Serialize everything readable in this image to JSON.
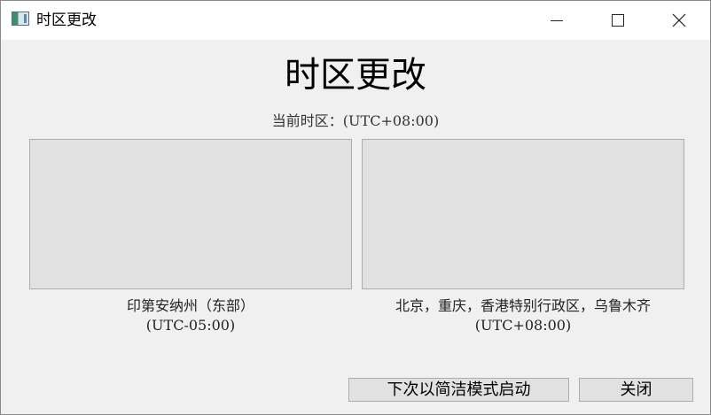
{
  "window": {
    "title": "时区更改"
  },
  "main": {
    "heading": "时区更改",
    "current_timezone": "当前时区：(UTC+08:00)"
  },
  "options": [
    {
      "name": "印第安纳州（东部）",
      "offset": "(UTC-05:00)"
    },
    {
      "name": "北京，重庆，香港特别行政区，乌鲁木齐",
      "offset": "(UTC+08:00)"
    }
  ],
  "buttons": {
    "simple_mode": "下次以简洁模式启动",
    "close": "关闭"
  },
  "icons": {
    "app": "app-window-icon",
    "minimize": "minimize-icon",
    "maximize": "maximize-icon",
    "close": "close-icon"
  }
}
